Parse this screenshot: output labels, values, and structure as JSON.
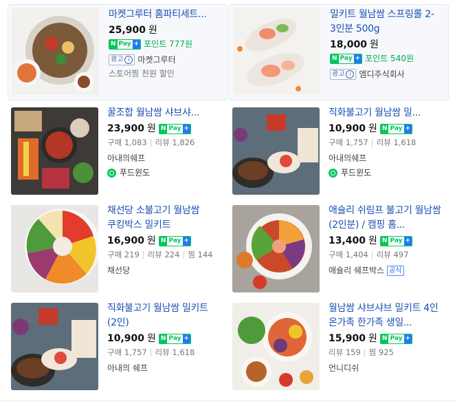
{
  "products": [
    {
      "title": "마켓그루터 홈파티세트...",
      "price": "25,900",
      "won": "원",
      "points": "포인트 777원",
      "seller": "마켓그루터",
      "ad": "광고",
      "extra": "스토어찜 천원 할인"
    },
    {
      "title": "밀키트 월남쌈 스프링롤 2-3인분 500g",
      "price": "18,000",
      "won": "원",
      "points": "포인트 540원",
      "seller": "엠디주식회사",
      "ad": "광고"
    },
    {
      "title": "꿀조합 월남쌈 샤브샤...",
      "price": "23,900",
      "won": "원",
      "buy": "구매 1,083",
      "review": "리뷰 1,826",
      "seller": "아내의쉐프",
      "foodwindow": "푸드윈도"
    },
    {
      "title": "직화불고기 월남쌈 밀...",
      "price": "10,900",
      "won": "원",
      "buy": "구매 1,757",
      "review": "리뷰 1,618",
      "seller": "아내의쉐프",
      "foodwindow": "푸드윈도"
    },
    {
      "title": "채선당 소불고기 월남쌈 쿠킹박스 밀키트",
      "price": "16,900",
      "won": "원",
      "buy": "구매 219",
      "review": "리뷰 224",
      "zzim": "찜 144",
      "seller": "채선당"
    },
    {
      "title": "애슐리 쉬림프 불고기 월남쌈 (2인분) / 캠핑 홈...",
      "price": "13,400",
      "won": "원",
      "buy": "구매 1,404",
      "review": "리뷰 497",
      "seller": "애슐리 쉐프박스",
      "official": "공식"
    },
    {
      "title": "직화불고기 월남쌈 밀키트(2인)",
      "price": "10,900",
      "won": "원",
      "buy": "구매 1,757",
      "review": "리뷰 1,618",
      "seller": "아내의 쉐프"
    },
    {
      "title": "월남쌈 샤브샤브 밀키트 4인 온가족 한가족 생일...",
      "price": "15,900",
      "won": "원",
      "review": "리뷰 159",
      "zzim": "찜 925",
      "seller": "언니디쉬"
    }
  ],
  "npay": {
    "n": "N",
    "pay": "Pay",
    "plus": "+"
  },
  "icons": {
    "info": "i"
  },
  "colors": {
    "title": "#1a4fb3",
    "npay": "#03c75a",
    "points": "#03a94e"
  }
}
